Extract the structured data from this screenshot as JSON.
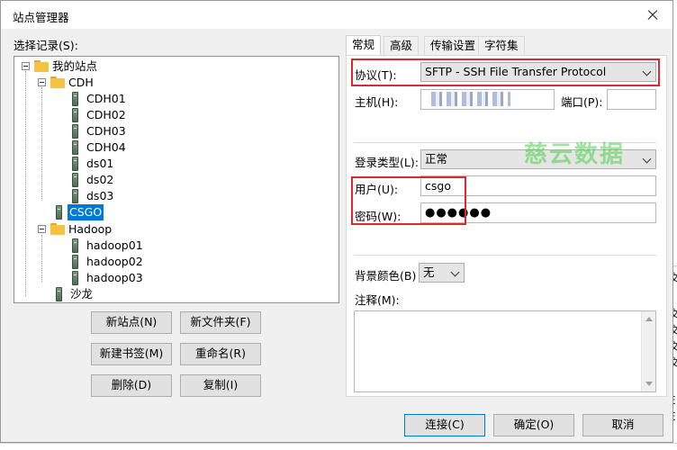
{
  "dialog": {
    "title": "站点管理器",
    "select_label": "选择记录(S):"
  },
  "tree": {
    "root": "我的站点",
    "cdh_folder": "CDH",
    "cdh_items": [
      "CDH01",
      "CDH02",
      "CDH03",
      "CDH04",
      "ds01",
      "ds02",
      "ds03"
    ],
    "csgo": "CSGO",
    "hadoop_folder": "Hadoop",
    "hadoop_items": [
      "hadoop01",
      "hadoop02",
      "hadoop03"
    ],
    "salon": "沙龙"
  },
  "left_buttons": {
    "new_site": "新站点(N)",
    "new_folder": "新文件夹(F)",
    "new_bookmark": "新建书签(M)",
    "rename": "重命名(R)",
    "delete": "删除(D)",
    "copy": "复制(I)"
  },
  "tabs": [
    "常规",
    "高级",
    "传输设置",
    "字符集"
  ],
  "general": {
    "protocol_label": "协议(T):",
    "protocol_value": "SFTP - SSH File Transfer Protocol",
    "host_label": "主机(H):",
    "port_label": "端口(P):",
    "port_value": "",
    "logon_type_label": "登录类型(L):",
    "logon_type_value": "正常",
    "user_label": "用户(U):",
    "user_value": "csgo",
    "password_label": "密码(W):",
    "password_value": "●●●●●●",
    "bg_color_label": "背景颜色(B)",
    "bg_color_value": "无",
    "comment_label": "注释(M):"
  },
  "watermark": "慈云数据",
  "footer": {
    "connect": "连接(C)",
    "ok": "确定(O)",
    "cancel": "取消"
  },
  "background": {
    "right_chars": [
      "文",
      "文",
      "文",
      "文",
      "文",
      "E",
      "E"
    ]
  },
  "colors": {
    "accent": "#0078d7",
    "highlight_box": "#e0272d",
    "watermark": "#4ecf4e"
  }
}
